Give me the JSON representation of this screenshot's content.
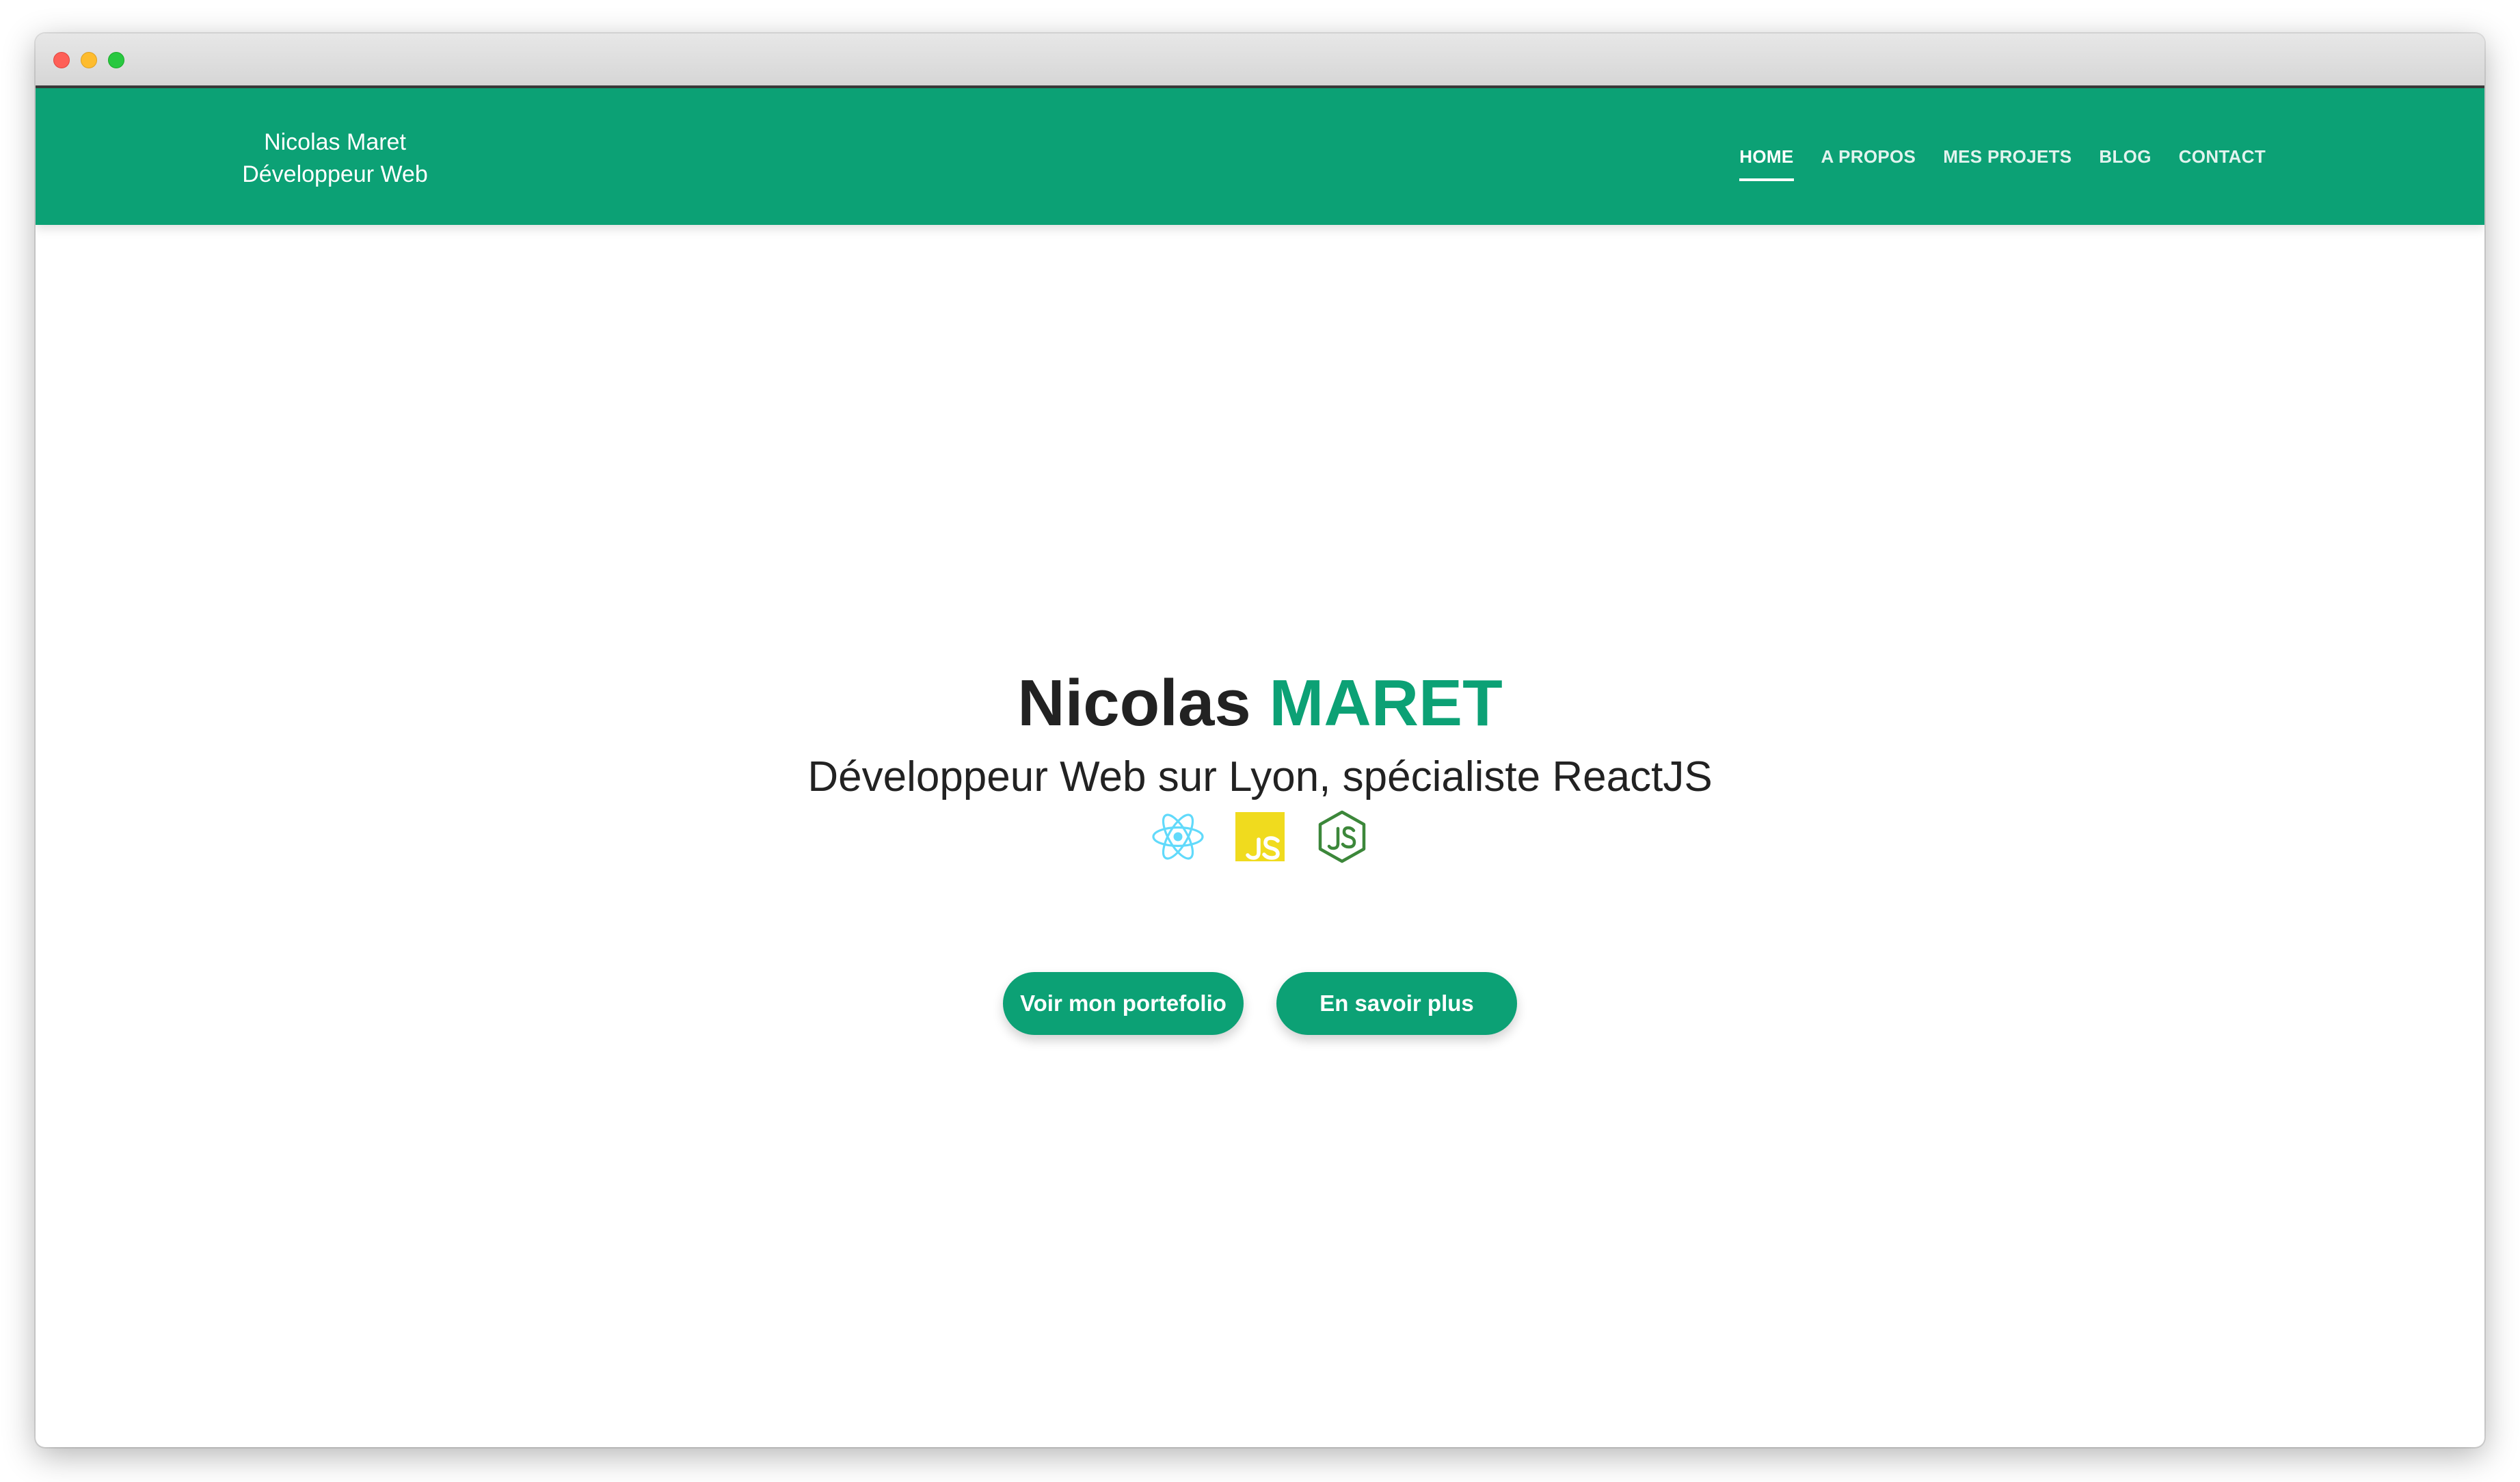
{
  "brand": {
    "line1": "Nicolas Maret",
    "line2": "Développeur Web"
  },
  "nav": {
    "items": [
      {
        "label": "HOME",
        "active": true
      },
      {
        "label": "A PROPOS",
        "active": false
      },
      {
        "label": "MES PROJETS",
        "active": false
      },
      {
        "label": "BLOG",
        "active": false
      },
      {
        "label": "CONTACT",
        "active": false
      }
    ]
  },
  "hero": {
    "first_name": "Nicolas",
    "last_name": "MARET",
    "subtitle": "Développeur Web sur Lyon, spécialiste ReactJS",
    "tech_icons": [
      "react-icon",
      "javascript-icon",
      "nodejs-icon"
    ],
    "buttons": {
      "portfolio": "Voir mon portefolio",
      "more": "En savoir plus"
    }
  },
  "colors": {
    "accent": "#0ca175",
    "text": "#222222",
    "react": "#61dafb",
    "javascript": "#f0db1e",
    "nodejs": "#3c873a"
  }
}
